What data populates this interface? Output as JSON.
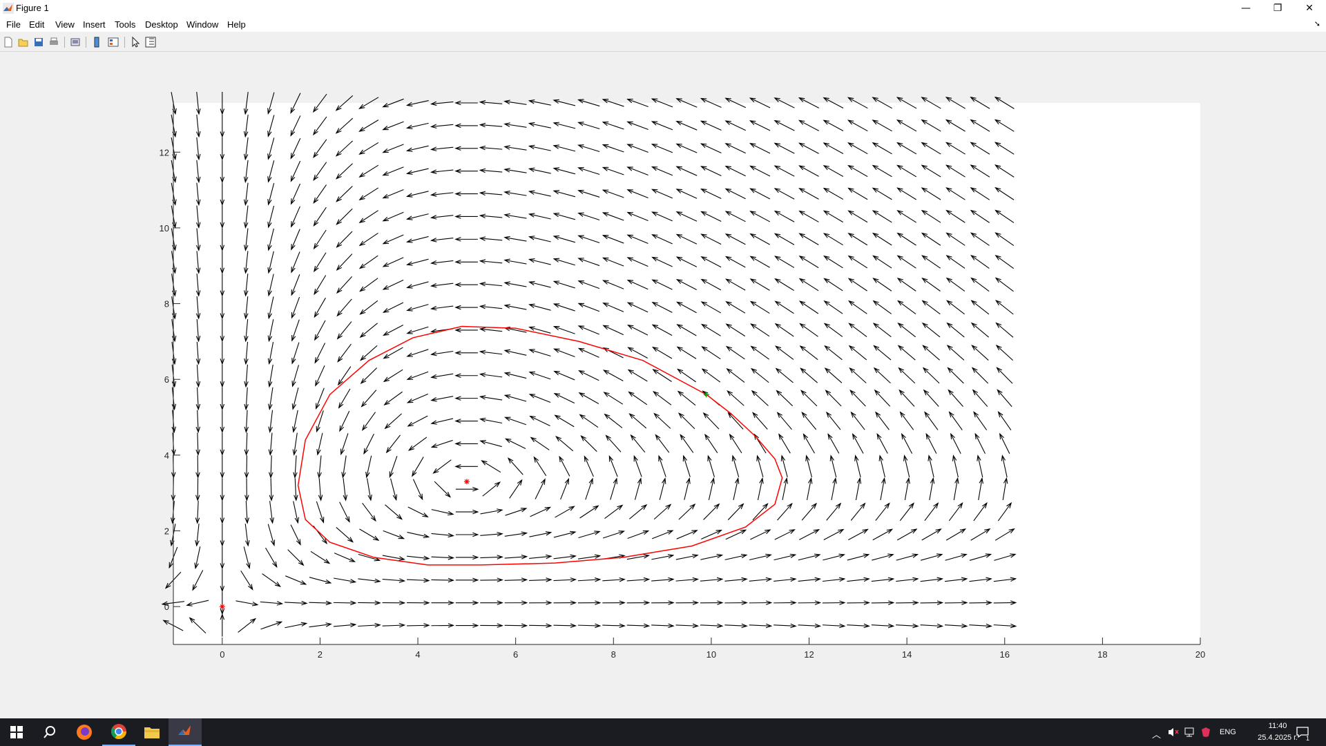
{
  "window": {
    "title": "Figure 1",
    "minimize": "—",
    "restore": "❐",
    "close": "✕"
  },
  "menu": [
    "File",
    "Edit",
    "View",
    "Insert",
    "Tools",
    "Desktop",
    "Window",
    "Help"
  ],
  "toolbar": [
    "new-figure",
    "open-file",
    "save-figure",
    "print-figure",
    "print-preview",
    "link-plot",
    "insert-colorbar",
    "edit-plot",
    "property-inspector"
  ],
  "chart_data": {
    "type": "quiver",
    "title": "",
    "xlabel": "",
    "ylabel": "",
    "xlim": [
      -1,
      20
    ],
    "ylim": [
      -1,
      13.3
    ],
    "xticks": [
      0,
      2,
      4,
      6,
      8,
      10,
      12,
      14,
      16,
      18,
      20
    ],
    "yticks": [
      0,
      2,
      4,
      6,
      8,
      10,
      12
    ],
    "vector_field": {
      "x_range": [
        -1,
        16
      ],
      "y_range": [
        -0.5,
        13.3
      ],
      "x_step": 0.5,
      "y_step": 0.6,
      "color": "#000000"
    },
    "equilibria": [
      {
        "x": 0,
        "y": 0,
        "color": "#ff0000",
        "marker": "*"
      },
      {
        "x": 5,
        "y": 3.3,
        "color": "#ff0000",
        "marker": "*"
      }
    ],
    "start_point": {
      "x": 9.9,
      "y": 5.6,
      "color": "#00aa00",
      "marker": "+"
    },
    "trajectory": {
      "color": "#ff0000",
      "points": [
        [
          9.9,
          5.6
        ],
        [
          10.4,
          5.1
        ],
        [
          10.9,
          4.5
        ],
        [
          11.3,
          3.9
        ],
        [
          11.45,
          3.4
        ],
        [
          11.3,
          2.7
        ],
        [
          10.7,
          2.1
        ],
        [
          9.6,
          1.6
        ],
        [
          8.2,
          1.3
        ],
        [
          6.8,
          1.15
        ],
        [
          5.3,
          1.1
        ],
        [
          4.2,
          1.1
        ],
        [
          3.1,
          1.3
        ],
        [
          2.2,
          1.7
        ],
        [
          1.7,
          2.3
        ],
        [
          1.55,
          3.2
        ],
        [
          1.7,
          4.4
        ],
        [
          2.2,
          5.6
        ],
        [
          3,
          6.5
        ],
        [
          3.9,
          7.1
        ],
        [
          4.9,
          7.4
        ],
        [
          6,
          7.35
        ],
        [
          7.3,
          7.0
        ],
        [
          8.6,
          6.5
        ],
        [
          9.9,
          5.6
        ]
      ]
    }
  },
  "taskbar": {
    "apps": [
      "windows-start",
      "search",
      "firefox",
      "chrome",
      "file-explorer",
      "matlab"
    ],
    "lang": "ENG",
    "time": "11:40",
    "date": "25.4.2025 г.",
    "notifications": "1"
  }
}
